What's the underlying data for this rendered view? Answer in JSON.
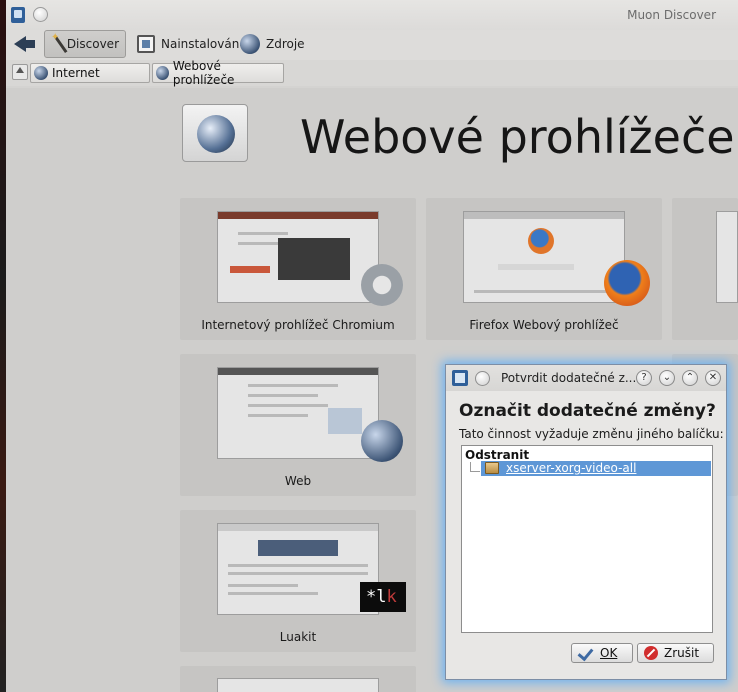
{
  "window": {
    "title": "Muon Discover"
  },
  "toolbar": {
    "back_icon": "back-arrow-icon",
    "discover_label": "Discover",
    "installed_label": "Nainstalováno",
    "sources_label": "Zdroje"
  },
  "breadcrumb": {
    "items": [
      {
        "label": "Internet"
      },
      {
        "label": "Webové prohlížeče"
      }
    ]
  },
  "page": {
    "title": "Webové prohlížeče"
  },
  "apps": [
    {
      "label": "Internetový prohlížeč Chromium"
    },
    {
      "label": "Firefox Webový prohlížeč"
    },
    {
      "label": "Web"
    },
    {
      "label": "Luakit"
    }
  ],
  "watermark": {
    "text_main": "*l",
    "text_accent": "k"
  },
  "dialog": {
    "title": "Potvrdit dodatečné z...",
    "heading": "Označit dodatečné změny?",
    "subtitle": "Tato činnost vyžaduje změnu jiného balíčku:",
    "group": "Odstranit",
    "package": "xserver-xorg-video-all",
    "ok_label": "OK",
    "cancel_label": "Zrušit",
    "help_btn": "?",
    "close_btn": "✕"
  },
  "colors": {
    "selection": "#5e97d6",
    "dialog_glow": "#6fb3f0",
    "cancel_icon": "#d12e2e"
  }
}
